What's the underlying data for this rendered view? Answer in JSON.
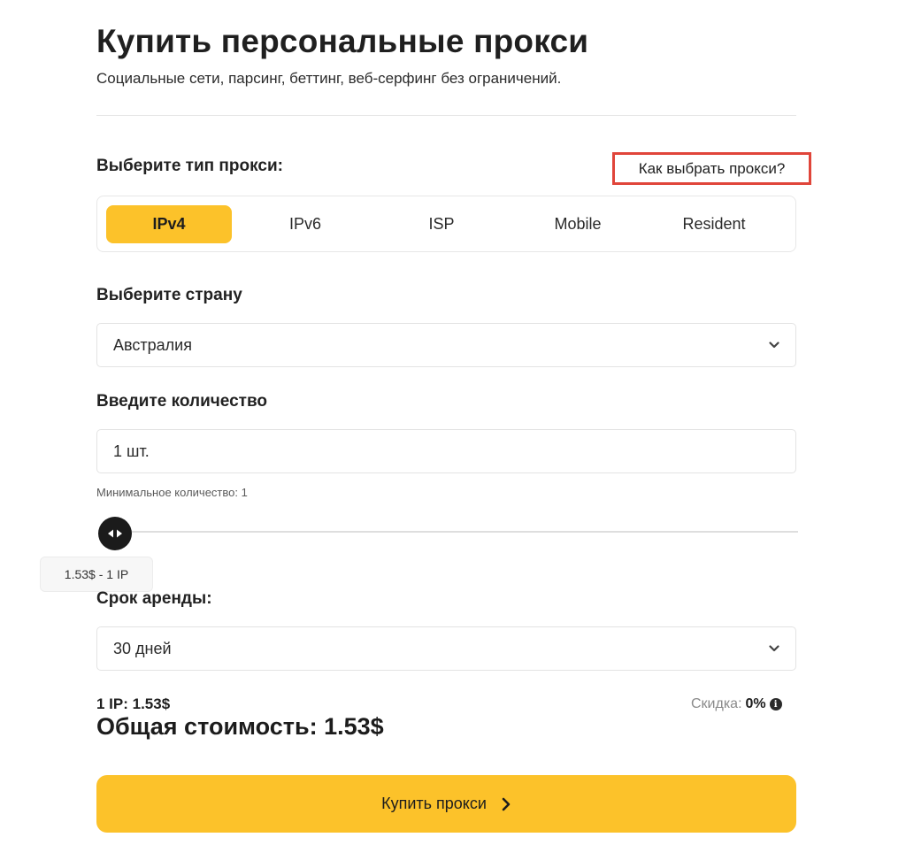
{
  "header": {
    "title": "Купить персональные прокси",
    "subtitle": "Социальные сети, парсинг, беттинг, веб-серфинг без ограничений."
  },
  "proxy_type": {
    "label": "Выберите тип прокси:",
    "help_link": "Как выбрать прокси?",
    "tabs": [
      {
        "label": "IPv4",
        "active": true
      },
      {
        "label": "IPv6",
        "active": false
      },
      {
        "label": "ISP",
        "active": false
      },
      {
        "label": "Mobile",
        "active": false
      },
      {
        "label": "Resident",
        "active": false
      }
    ]
  },
  "country": {
    "label": "Выберите страну",
    "selected": "Австралия",
    "icon": "chevron-down-icon"
  },
  "quantity": {
    "label": "Введите количество",
    "value": "1 шт.",
    "hint": "Минимальное количество: 1",
    "slider_value": 1,
    "tooltip": "1.53$ - 1 IP"
  },
  "rent": {
    "label": "Срок аренды:",
    "selected": "30 дней",
    "icon": "chevron-down-icon"
  },
  "summary": {
    "price_per_ip": "1 IP: 1.53$",
    "total": "Общая стоимость: 1.53$",
    "discount_label": "Скидка:",
    "discount_value": "0%",
    "info_icon": "info-icon"
  },
  "buy": {
    "label": "Купить прокси",
    "icon": "chevron-right-icon"
  },
  "colors": {
    "accent": "#fcc22a",
    "highlight_border": "#e0453a"
  }
}
